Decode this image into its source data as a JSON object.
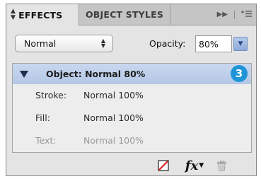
{
  "tabs": {
    "effects": "EFFECTS",
    "object_styles": "OBJECT STYLES"
  },
  "icons": {
    "tab_arrows": "collapse-arrows-icon",
    "forward": "double-arrow-icon",
    "menu": "panel-menu-icon",
    "clear": "clear-effects-icon",
    "fx": "fx-icon",
    "trash": "trash-icon"
  },
  "controls": {
    "blend_mode": "Normal",
    "opacity_label": "Opacity:",
    "opacity_value": "80%"
  },
  "object_row": {
    "text": "Object: Normal 80%",
    "badge": "3"
  },
  "attributes": [
    {
      "label": "Stroke:",
      "value": "Normal 100%"
    },
    {
      "label": "Fill:",
      "value": "Normal 100%"
    },
    {
      "label": "Text:",
      "value": "Normal 100%"
    }
  ],
  "toolbar": {
    "fx_label": "fx"
  },
  "colors": {
    "selection": "#b3c7e6",
    "badge": "#1f95d8",
    "clear_icon_red": "#d8262c"
  }
}
